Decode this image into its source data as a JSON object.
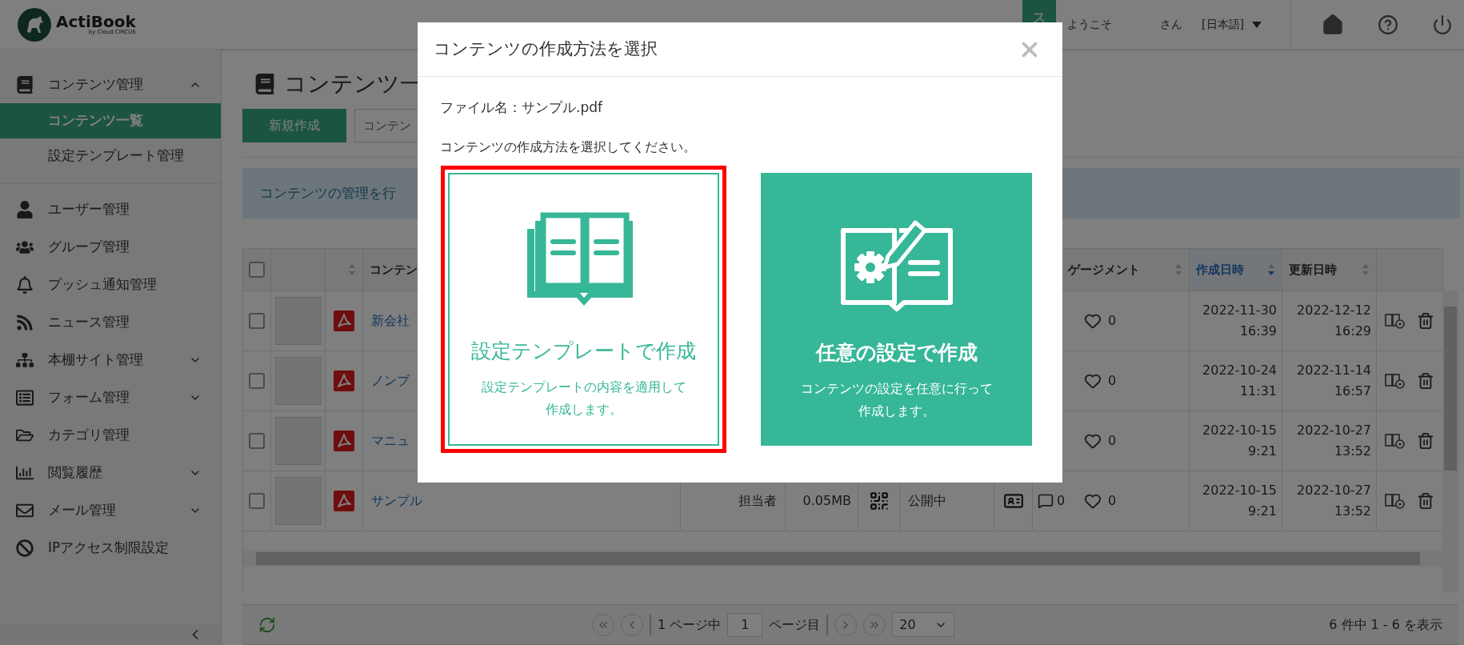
{
  "header": {
    "logo": {
      "name": "ActiBook",
      "byline": "by Cloud CIRCUS"
    },
    "avatar_initial": "ス",
    "greeting": "ようこそ",
    "user_suffix": "さん",
    "language": "[日本語]"
  },
  "sidebar": {
    "items": [
      {
        "kind": "group",
        "label": "コンテンツ管理",
        "expanded": true,
        "children": [
          {
            "label": "コンテンツ一覧",
            "selected": true
          },
          {
            "label": "設定テンプレート管理",
            "selected": false
          }
        ]
      },
      {
        "kind": "link",
        "label": "ユーザー管理"
      },
      {
        "kind": "link",
        "label": "グループ管理"
      },
      {
        "kind": "link",
        "label": "プッシュ通知管理"
      },
      {
        "kind": "link",
        "label": "ニュース管理"
      },
      {
        "kind": "group",
        "label": "本棚サイト管理",
        "expanded": false
      },
      {
        "kind": "group",
        "label": "フォーム管理",
        "expanded": false
      },
      {
        "kind": "link",
        "label": "カテゴリ管理"
      },
      {
        "kind": "group",
        "label": "閲覧履歴",
        "expanded": false
      },
      {
        "kind": "group",
        "label": "メール管理",
        "expanded": false
      },
      {
        "kind": "link",
        "label": "IPアクセス制限設定"
      }
    ]
  },
  "page": {
    "title": "コンテンツ一",
    "new_button": "新規作成",
    "search": {
      "placeholder": "コンテン"
    },
    "info": "コンテンツの管理を行"
  },
  "table": {
    "select_all": {
      "checked": false
    },
    "columns": [
      {
        "kind": "type",
        "sorted": false
      },
      {
        "kind": "name",
        "label": "コンテン"
      },
      {
        "kind": "engagement",
        "label": "ゲージメント",
        "sorted": false
      },
      {
        "kind": "created",
        "label": "作成日時",
        "sorted": true
      },
      {
        "kind": "updated",
        "label": "更新日時",
        "sorted": false
      }
    ],
    "rows": [
      {
        "checked": false,
        "name": "新会社",
        "likes": "0",
        "created_date": "2022-11-30",
        "created_time": "16:39",
        "updated_date": "2022-12-12",
        "updated_time": "16:29"
      },
      {
        "checked": false,
        "name": "ノンブ",
        "likes": "0",
        "created_date": "2022-10-24",
        "created_time": "11:31",
        "updated_date": "2022-11-14",
        "updated_time": "16:57"
      },
      {
        "checked": false,
        "name": "マニュ",
        "likes": "0",
        "created_date": "2022-10-15",
        "created_time": "9:21",
        "updated_date": "2022-10-27",
        "updated_time": "13:52"
      },
      {
        "checked": false,
        "name": "サンプル",
        "owner": "担当者",
        "size": "0.05MB",
        "status": "公開中",
        "comments": "0",
        "likes": "0",
        "created_date": "2022-10-15",
        "created_time": "9:21",
        "updated_date": "2022-10-27",
        "updated_time": "13:52"
      }
    ]
  },
  "footer": {
    "page_of": "1 ページ中",
    "page": "1",
    "page_suffix": "ページ目",
    "per_page": "20",
    "summary": "6 件中 1 - 6 を表示"
  },
  "modal": {
    "title": "コンテンツの作成方法を選択",
    "file_label": "ファイル名：サンプル.pdf",
    "prompt": "コンテンツの作成方法を選択してください。",
    "options": [
      {
        "kind": "template",
        "title": "設定テンプレートで作成",
        "description_lines": [
          "設定テンプレートの内容を適用して",
          "作成します。"
        ],
        "highlighted": true,
        "filled": false
      },
      {
        "kind": "custom",
        "title": "任意の設定で作成",
        "description_lines": [
          "コンテンツの設定を任意に行って",
          "作成します。"
        ],
        "highlighted": false,
        "filled": true
      }
    ]
  }
}
